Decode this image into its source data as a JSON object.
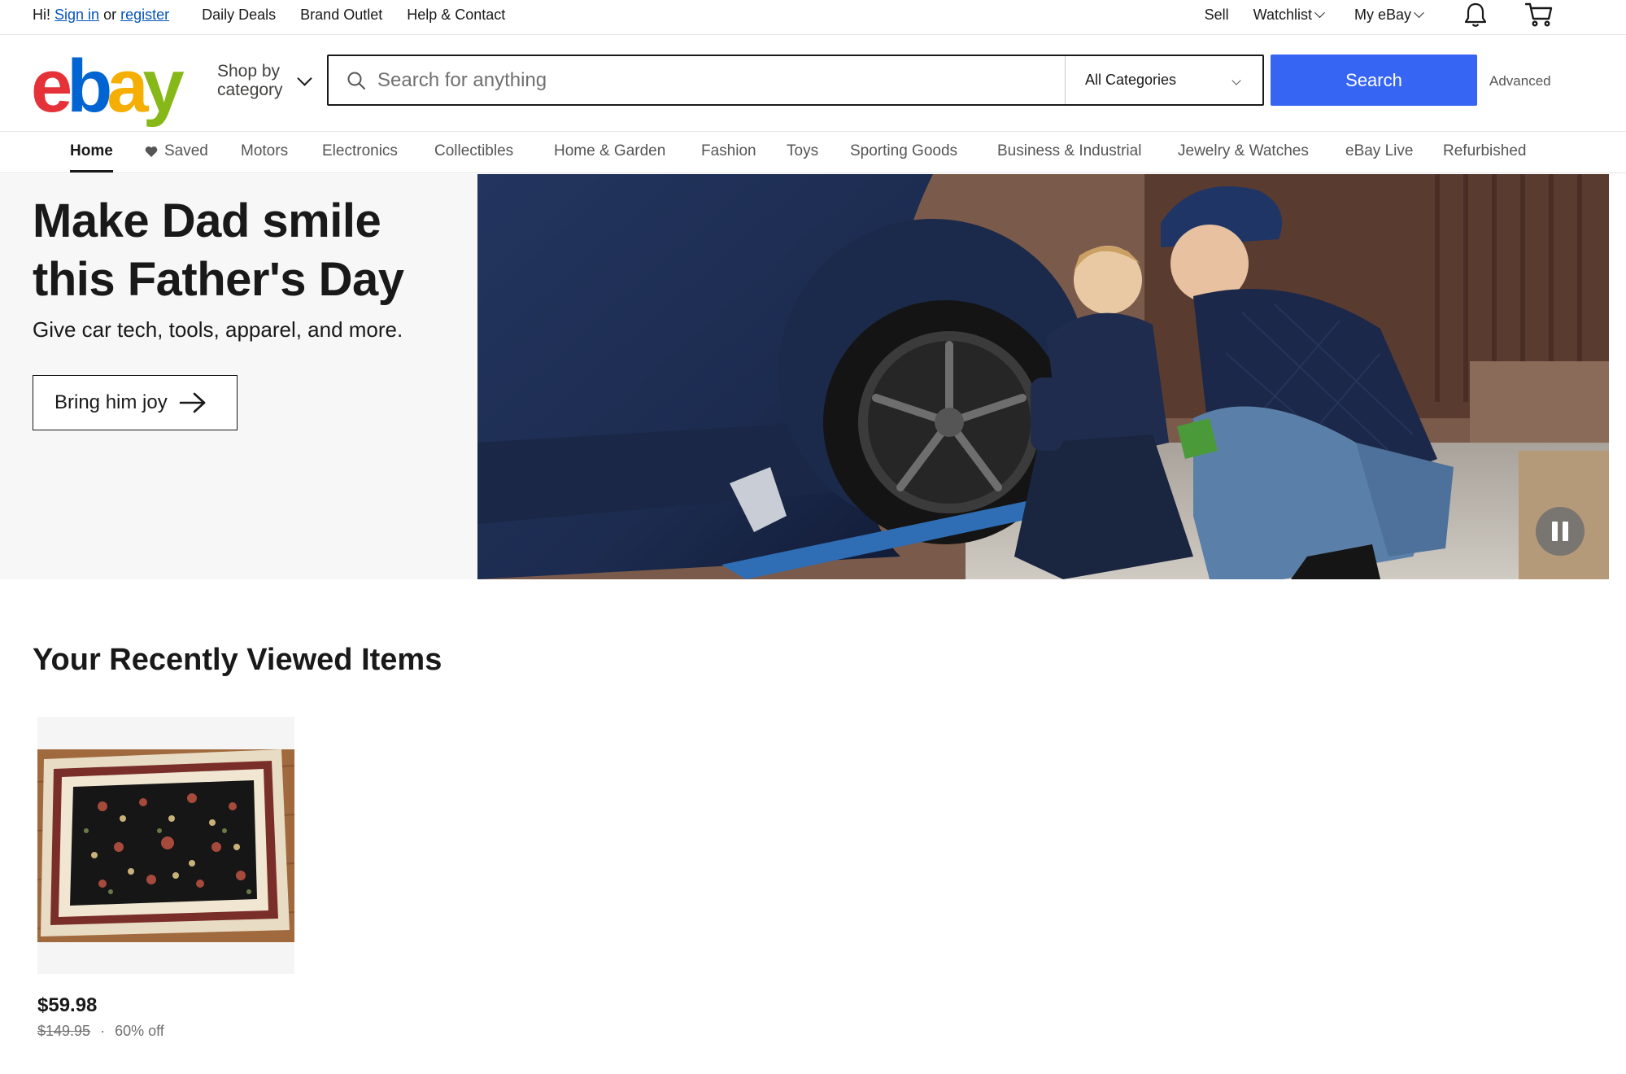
{
  "topbar": {
    "greeting": "Hi!",
    "sign_in": "Sign in",
    "or": "or",
    "register": "register",
    "links": [
      "Daily Deals",
      "Brand Outlet",
      "Help & Contact"
    ],
    "sell": "Sell",
    "watchlist": "Watchlist",
    "my_ebay": "My eBay"
  },
  "header": {
    "logo": {
      "e": "e",
      "b": "b",
      "a": "a",
      "y": "y"
    },
    "shop_by_line1": "Shop by",
    "shop_by_line2": "category",
    "search_placeholder": "Search for anything",
    "category_select": "All Categories",
    "search_button": "Search",
    "advanced": "Advanced"
  },
  "nav": {
    "items": [
      "Home",
      "Saved",
      "Motors",
      "Electronics",
      "Collectibles",
      "Home & Garden",
      "Fashion",
      "Toys",
      "Sporting Goods",
      "Business & Industrial",
      "Jewelry & Watches",
      "eBay Live",
      "Refurbished"
    ],
    "active": "Home"
  },
  "hero": {
    "title": "Make Dad smile this Father's Day",
    "subtitle": "Give car tech, tools, apparel, and more.",
    "cta": "Bring him joy"
  },
  "recently_viewed": {
    "title": "Your Recently Viewed Items",
    "items": [
      {
        "price": "$59.98",
        "original_price": "$149.95",
        "separator": "·",
        "discount": "60% off"
      }
    ]
  },
  "colors": {
    "logo_e": "#e53238",
    "logo_b": "#0064d2",
    "logo_a": "#f5af02",
    "logo_y": "#86b817",
    "search_button": "#3665f3",
    "link": "#0654ba"
  },
  "icons": [
    "search-icon",
    "chevron-down-icon",
    "heart-icon",
    "bell-icon",
    "cart-icon",
    "arrow-right-icon",
    "pause-icon"
  ]
}
